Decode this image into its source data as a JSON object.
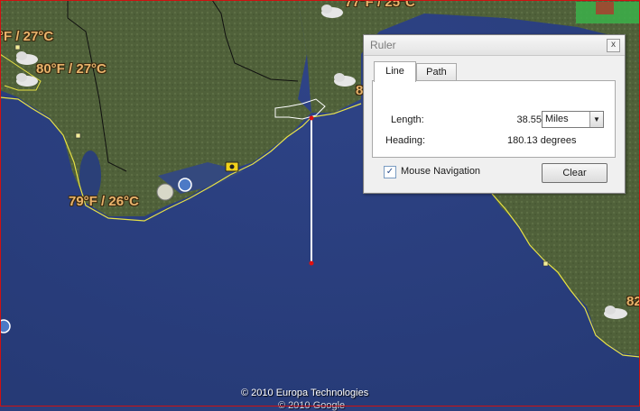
{
  "map": {
    "weather_labels": [
      {
        "id": "w1",
        "text": "°F / 27°C"
      },
      {
        "id": "w2",
        "text": "80°F / 27°C"
      },
      {
        "id": "w3",
        "text": "79°F / 26°C"
      },
      {
        "id": "w4",
        "text": "77°F / 25°C"
      },
      {
        "id": "w5",
        "text": "8"
      },
      {
        "id": "w6",
        "text": "82"
      }
    ],
    "copyright": "© 2010 Europa Technologies",
    "copyright_2": "© 2010 Google",
    "colors": {
      "ocean": "#2b3f7d",
      "land": "#4f6233",
      "coastline": "#e8e245",
      "ruler_line": "#ffffff",
      "border": "#d01010"
    }
  },
  "ruler": {
    "title": "Ruler",
    "close_label": "x",
    "tabs": [
      {
        "label": "Line",
        "active": true
      },
      {
        "label": "Path",
        "active": false
      }
    ],
    "length_label": "Length:",
    "length_value": "38.55",
    "unit": "Miles",
    "heading_label": "Heading:",
    "heading_value": "180.13 degrees",
    "mouse_navigation_label": "Mouse Navigation",
    "mouse_navigation_checked": true,
    "clear_label": "Clear"
  }
}
